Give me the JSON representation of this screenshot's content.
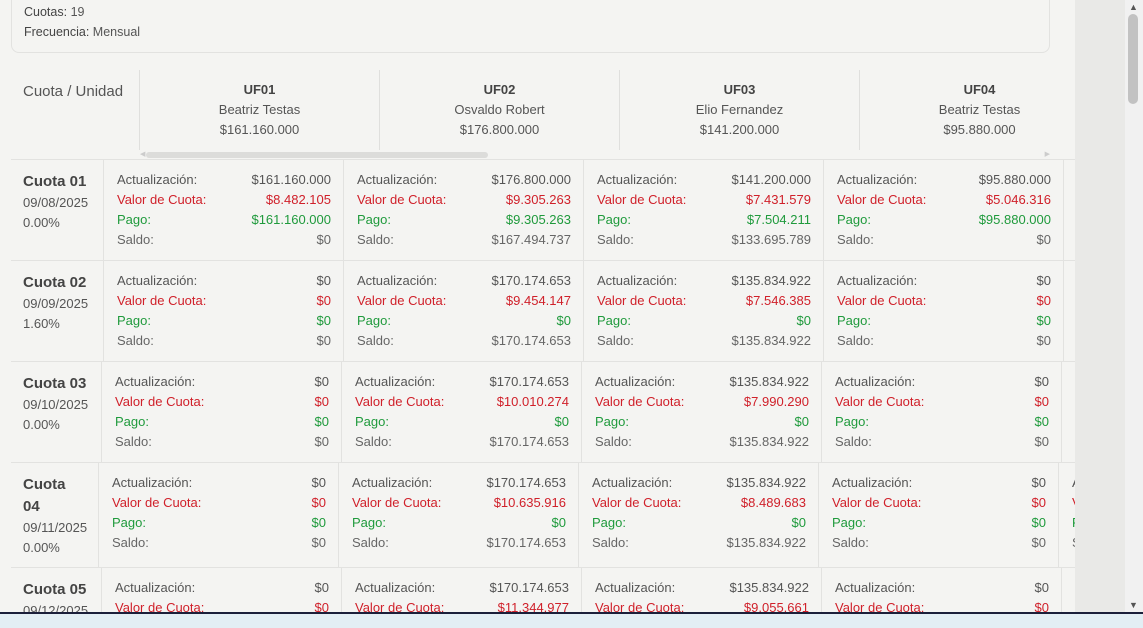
{
  "info": {
    "cuotas_label": "Cuotas:",
    "cuotas_value": "19",
    "frecuencia_label": "Frecuencia:",
    "frecuencia_value": "Mensual"
  },
  "table": {
    "corner_label": "Cuota / Unidad",
    "units": [
      {
        "code": "UF01",
        "owner": "Beatriz Testas",
        "amount": "$161.160.000"
      },
      {
        "code": "UF02",
        "owner": "Osvaldo Robert",
        "amount": "$176.800.000"
      },
      {
        "code": "UF03",
        "owner": "Elio Fernandez",
        "amount": "$141.200.000"
      },
      {
        "code": "UF04",
        "owner": "Beatriz Testas",
        "amount": "$95.880.000"
      }
    ],
    "line_labels": {
      "act": "Actualización:",
      "valor": "Valor de Cuota:",
      "pago": "Pago:",
      "saldo": "Saldo:"
    },
    "partial_labels": {
      "act": "Actualiza",
      "valor": "Valor de",
      "pago": "Pago:",
      "saldo": "Saldo:"
    },
    "rows": [
      {
        "title": "Cuota 01",
        "date": "09/08/2025",
        "pct": "0.00%",
        "cells": [
          {
            "act": "$161.160.000",
            "valor": "$8.482.105",
            "pago": "$161.160.000",
            "saldo": "$0"
          },
          {
            "act": "$176.800.000",
            "valor": "$9.305.263",
            "pago": "$9.305.263",
            "saldo": "$167.494.737"
          },
          {
            "act": "$141.200.000",
            "valor": "$7.431.579",
            "pago": "$7.504.211",
            "saldo": "$133.695.789"
          },
          {
            "act": "$95.880.000",
            "valor": "$5.046.316",
            "pago": "$95.880.000",
            "saldo": "$0"
          }
        ]
      },
      {
        "title": "Cuota 02",
        "date": "09/09/2025",
        "pct": "1.60%",
        "cells": [
          {
            "act": "$0",
            "valor": "$0",
            "pago": "$0",
            "saldo": "$0"
          },
          {
            "act": "$170.174.653",
            "valor": "$9.454.147",
            "pago": "$0",
            "saldo": "$170.174.653"
          },
          {
            "act": "$135.834.922",
            "valor": "$7.546.385",
            "pago": "$0",
            "saldo": "$135.834.922"
          },
          {
            "act": "$0",
            "valor": "$0",
            "pago": "$0",
            "saldo": "$0"
          }
        ]
      },
      {
        "title": "Cuota 03",
        "date": "09/10/2025",
        "pct": "0.00%",
        "cells": [
          {
            "act": "$0",
            "valor": "$0",
            "pago": "$0",
            "saldo": "$0"
          },
          {
            "act": "$170.174.653",
            "valor": "$10.010.274",
            "pago": "$0",
            "saldo": "$170.174.653"
          },
          {
            "act": "$135.834.922",
            "valor": "$7.990.290",
            "pago": "$0",
            "saldo": "$135.834.922"
          },
          {
            "act": "$0",
            "valor": "$0",
            "pago": "$0",
            "saldo": "$0"
          }
        ]
      },
      {
        "title": "Cuota 04",
        "date": "09/11/2025",
        "pct": "0.00%",
        "cells": [
          {
            "act": "$0",
            "valor": "$0",
            "pago": "$0",
            "saldo": "$0"
          },
          {
            "act": "$170.174.653",
            "valor": "$10.635.916",
            "pago": "$0",
            "saldo": "$170.174.653"
          },
          {
            "act": "$135.834.922",
            "valor": "$8.489.683",
            "pago": "$0",
            "saldo": "$135.834.922"
          },
          {
            "act": "$0",
            "valor": "$0",
            "pago": "$0",
            "saldo": "$0"
          }
        ]
      },
      {
        "title": "Cuota 05",
        "date": "09/12/2025",
        "pct": "",
        "cells": [
          {
            "act": "$0",
            "valor": "$0",
            "pago": "",
            "saldo": ""
          },
          {
            "act": "$170.174.653",
            "valor": "$11.344.977",
            "pago": "",
            "saldo": ""
          },
          {
            "act": "$135.834.922",
            "valor": "$9.055.661",
            "pago": "",
            "saldo": ""
          },
          {
            "act": "$0",
            "valor": "$0",
            "pago": "",
            "saldo": ""
          }
        ]
      }
    ]
  }
}
